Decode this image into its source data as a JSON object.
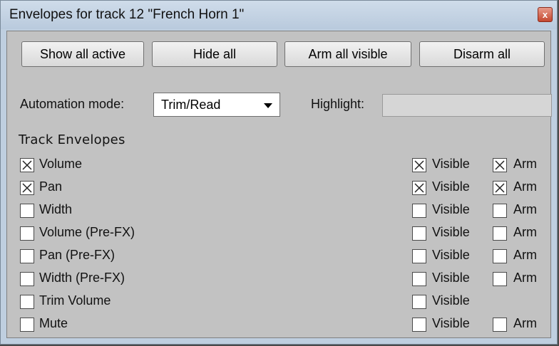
{
  "window": {
    "title": "Envelopes for track 12 \"French Horn 1\"",
    "close_icon": "close-icon"
  },
  "buttons": {
    "show_all_active": "Show all active",
    "hide_all": "Hide all",
    "arm_all_visible": "Arm all visible",
    "disarm_all": "Disarm all"
  },
  "automation": {
    "label": "Automation mode:",
    "selected": "Trim/Read"
  },
  "highlight": {
    "label": "Highlight:",
    "value": ""
  },
  "section_title": "Track Envelopes",
  "visible_label": "Visible",
  "arm_label": "Arm",
  "envelopes": [
    {
      "name": "Volume",
      "checked": true,
      "visible": true,
      "arm": true,
      "has_arm": true
    },
    {
      "name": "Pan",
      "checked": true,
      "visible": true,
      "arm": true,
      "has_arm": true
    },
    {
      "name": "Width",
      "checked": false,
      "visible": false,
      "arm": false,
      "has_arm": true
    },
    {
      "name": "Volume (Pre-FX)",
      "checked": false,
      "visible": false,
      "arm": false,
      "has_arm": true
    },
    {
      "name": "Pan (Pre-FX)",
      "checked": false,
      "visible": false,
      "arm": false,
      "has_arm": true
    },
    {
      "name": "Width (Pre-FX)",
      "checked": false,
      "visible": false,
      "arm": false,
      "has_arm": true
    },
    {
      "name": "Trim Volume",
      "checked": false,
      "visible": false,
      "arm": false,
      "has_arm": false
    },
    {
      "name": "Mute",
      "checked": false,
      "visible": false,
      "arm": false,
      "has_arm": true
    }
  ]
}
